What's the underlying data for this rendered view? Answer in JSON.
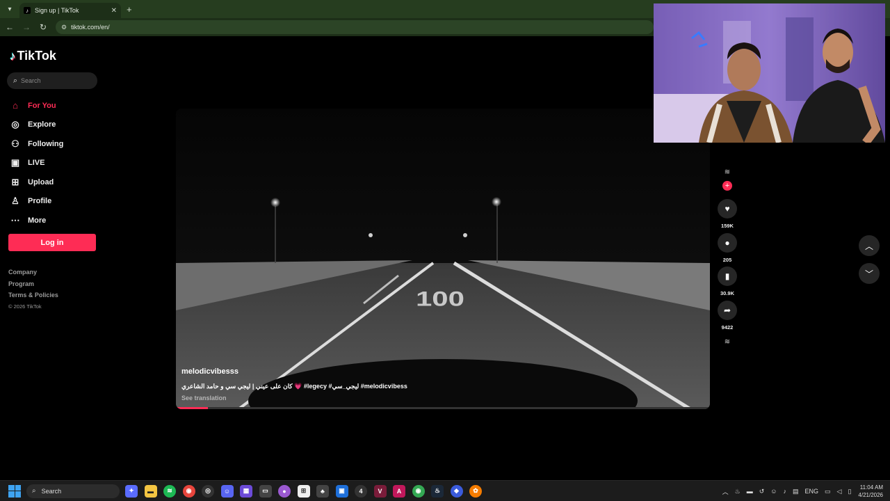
{
  "browser": {
    "tab_title": "Sign up | TikTok",
    "url": "tiktok.com/en/",
    "new_tab_symbol": "+",
    "close_symbol": "✕"
  },
  "sidebar": {
    "logo": "TikTok",
    "search_placeholder": "Search",
    "nav": [
      {
        "label": "For You",
        "icon": "home-icon",
        "active": true
      },
      {
        "label": "Explore",
        "icon": "compass-icon"
      },
      {
        "label": "Following",
        "icon": "following-icon"
      },
      {
        "label": "LIVE",
        "icon": "live-icon"
      },
      {
        "label": "Upload",
        "icon": "upload-icon"
      },
      {
        "label": "Profile",
        "icon": "profile-icon"
      },
      {
        "label": "More",
        "icon": "more-icon"
      }
    ],
    "login_label": "Log in",
    "footer": [
      "Company",
      "Program",
      "Terms & Policies"
    ],
    "copyright": "© 2026 TikTok"
  },
  "video": {
    "username": "melodicvibesss",
    "caption": "كان على عيني | ليجي سي و حامد الشاعري 💗 #legecy #ليجي_سي #melodicvibess",
    "see_translation": "See translation",
    "progress": 0.06,
    "road_text": "100"
  },
  "actions": {
    "likes": "159K",
    "comments": "205",
    "saves": "30.9K",
    "shares": "9422"
  },
  "taskbar": {
    "search_label": "Search",
    "language": "ENG",
    "time": "11:04 AM",
    "date": "4/21/2026"
  },
  "colors": {
    "accent": "#fe2c55",
    "chrome": "#263d1f"
  }
}
